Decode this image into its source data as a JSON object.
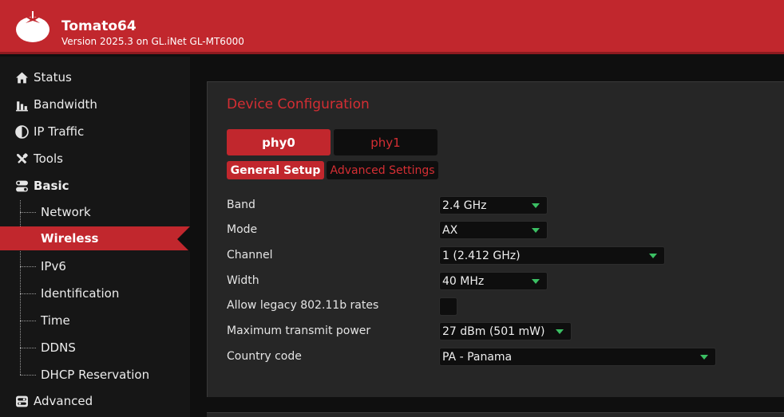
{
  "header": {
    "title": "Tomato64",
    "subtitle": "Version 2025.3 on GL.iNet GL-MT6000",
    "brand_color": "#c1272d"
  },
  "sidebar": {
    "items": [
      {
        "label": "Status",
        "icon": "home-icon"
      },
      {
        "label": "Bandwidth",
        "icon": "bar-chart-icon"
      },
      {
        "label": "IP Traffic",
        "icon": "pie-chart-icon"
      },
      {
        "label": "Tools",
        "icon": "tools-icon"
      },
      {
        "label": "Basic",
        "icon": "toggle-icon"
      },
      {
        "label": "Network"
      },
      {
        "label": "Wireless",
        "active": true
      },
      {
        "label": "IPv6"
      },
      {
        "label": "Identification"
      },
      {
        "label": "Time"
      },
      {
        "label": "DDNS"
      },
      {
        "label": "DHCP Reservation"
      },
      {
        "label": "Advanced",
        "icon": "advanced-icon"
      }
    ]
  },
  "main": {
    "title": "Device Configuration",
    "tabs": [
      {
        "label": "phy0",
        "active": true
      },
      {
        "label": "phy1",
        "active": false
      }
    ],
    "subtabs": [
      {
        "label": "General Setup",
        "active": true
      },
      {
        "label": "Advanced Settings",
        "active": false
      }
    ],
    "fields": [
      {
        "label": "Band",
        "value": "2.4 GHz"
      },
      {
        "label": "Mode",
        "value": "AX"
      },
      {
        "label": "Channel",
        "value": "1 (2.412 GHz)"
      },
      {
        "label": "Width",
        "value": "40 MHz"
      },
      {
        "label": "Allow legacy 802.11b rates",
        "checked": false
      },
      {
        "label": "Maximum transmit power",
        "value": "27 dBm (501 mW)"
      },
      {
        "label": "Country code",
        "value": "PA - Panama"
      }
    ]
  },
  "colors": {
    "accent": "#c1272d",
    "accent_text": "#d42e33",
    "dropdown_arrow": "#3bbf63",
    "panel_bg": "#262626",
    "sidebar_bg": "#161616"
  }
}
